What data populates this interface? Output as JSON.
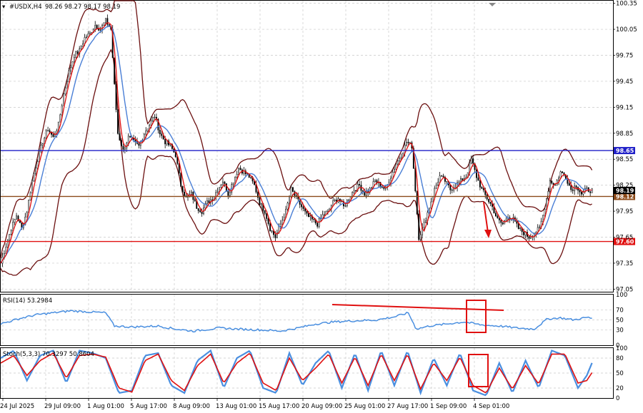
{
  "header": {
    "symbol_label": "#USDX,H4",
    "ohlc": "98.26 98.27 98.17 98.19"
  },
  "rsi_panel": {
    "label": "RSI(14) 53.2984",
    "levels": [
      "100",
      "70",
      "50",
      "30",
      "0"
    ]
  },
  "stoch_panel": {
    "label": "Stoch(5,3,3) 70.3297 50.8604",
    "levels": [
      "100",
      "80",
      "50",
      "20",
      "0"
    ]
  },
  "colors": {
    "candle": "#000000",
    "bollinger": "#6b0f0f",
    "ma_fast": "#e01010",
    "ma_slow": "#4a7fd6",
    "resistance": "#1f1fc8",
    "support": "#e01010",
    "current": "#8b4a1a",
    "rsi": "#4a8fe0",
    "stoch_main": "#4a8fe0",
    "stoch_signal": "#e01010",
    "annotation": "#e01010"
  },
  "chart_data": [
    {
      "type": "candlestick",
      "title": "#USDX,H4",
      "y_ticks": [
        "100.35",
        "100.05",
        "99.75",
        "99.45",
        "99.15",
        "98.85",
        "98.55",
        "98.25",
        "97.95",
        "97.65",
        "97.35",
        "97.05"
      ],
      "ylim": [
        97.02,
        100.38
      ],
      "x_ticks": [
        "24 Jul 2025",
        "29 Jul 09:00",
        "1 Aug 01:00",
        "5 Aug 17:00",
        "8 Aug 09:00",
        "13 Aug 01:00",
        "15 Aug 17:00",
        "20 Aug 09:00",
        "25 Aug 01:00",
        "27 Aug 17:00",
        "1 Sep 09:00",
        "4 Sep 01:00"
      ],
      "horizontal_lines": [
        {
          "label": "98.65",
          "value": 98.65,
          "color": "#1f1fc8"
        },
        {
          "label": "97.60",
          "value": 97.6,
          "color": "#e01010"
        },
        {
          "label": "98.12",
          "value": 98.12,
          "color": "#8b4a1a"
        }
      ],
      "current_price_label": "98.19",
      "current_price": 98.19,
      "price_path": [
        [
          0,
          97.35
        ],
        [
          6,
          97.55
        ],
        [
          12,
          97.75
        ],
        [
          18,
          97.9
        ],
        [
          24,
          97.75
        ],
        [
          30,
          97.95
        ],
        [
          36,
          98.3
        ],
        [
          42,
          98.55
        ],
        [
          48,
          98.75
        ],
        [
          54,
          98.9
        ],
        [
          60,
          98.8
        ],
        [
          66,
          98.95
        ],
        [
          72,
          99.3
        ],
        [
          78,
          99.55
        ],
        [
          84,
          99.75
        ],
        [
          90,
          99.8
        ],
        [
          96,
          99.95
        ],
        [
          102,
          100.0
        ],
        [
          108,
          100.1
        ],
        [
          114,
          100.05
        ],
        [
          120,
          100.15
        ],
        [
          126,
          100.05
        ],
        [
          130,
          99.4
        ],
        [
          134,
          98.85
        ],
        [
          140,
          98.65
        ],
        [
          146,
          98.8
        ],
        [
          152,
          98.75
        ],
        [
          158,
          98.7
        ],
        [
          164,
          98.85
        ],
        [
          170,
          98.95
        ],
        [
          176,
          99.05
        ],
        [
          182,
          98.85
        ],
        [
          188,
          98.75
        ],
        [
          194,
          98.7
        ],
        [
          200,
          98.6
        ],
        [
          206,
          98.25
        ],
        [
          212,
          98.1
        ],
        [
          218,
          98.15
        ],
        [
          224,
          98.0
        ],
        [
          230,
          97.95
        ],
        [
          236,
          98.05
        ],
        [
          242,
          98.1
        ],
        [
          248,
          98.2
        ],
        [
          254,
          98.3
        ],
        [
          260,
          98.15
        ],
        [
          266,
          98.3
        ],
        [
          272,
          98.45
        ],
        [
          278,
          98.4
        ],
        [
          284,
          98.35
        ],
        [
          290,
          98.25
        ],
        [
          296,
          98.05
        ],
        [
          302,
          97.95
        ],
        [
          308,
          97.75
        ],
        [
          314,
          97.65
        ],
        [
          320,
          97.8
        ],
        [
          326,
          97.95
        ],
        [
          332,
          98.2
        ],
        [
          338,
          98.1
        ],
        [
          344,
          98.0
        ],
        [
          350,
          97.9
        ],
        [
          356,
          97.85
        ],
        [
          362,
          97.8
        ],
        [
          368,
          97.9
        ],
        [
          374,
          97.95
        ],
        [
          380,
          98.05
        ],
        [
          386,
          98.1
        ],
        [
          392,
          98.0
        ],
        [
          398,
          98.1
        ],
        [
          404,
          98.2
        ],
        [
          410,
          98.25
        ],
        [
          416,
          98.15
        ],
        [
          422,
          98.2
        ],
        [
          428,
          98.3
        ],
        [
          434,
          98.25
        ],
        [
          440,
          98.2
        ],
        [
          446,
          98.35
        ],
        [
          452,
          98.5
        ],
        [
          458,
          98.6
        ],
        [
          464,
          98.75
        ],
        [
          470,
          98.7
        ],
        [
          474,
          98.2
        ],
        [
          478,
          97.65
        ],
        [
          484,
          97.8
        ],
        [
          490,
          98.0
        ],
        [
          496,
          98.2
        ],
        [
          502,
          98.35
        ],
        [
          508,
          98.3
        ],
        [
          514,
          98.2
        ],
        [
          520,
          98.25
        ],
        [
          526,
          98.3
        ],
        [
          532,
          98.35
        ],
        [
          538,
          98.55
        ],
        [
          544,
          98.35
        ],
        [
          550,
          98.2
        ],
        [
          556,
          98.1
        ],
        [
          562,
          98.0
        ],
        [
          568,
          97.85
        ],
        [
          574,
          97.8
        ],
        [
          580,
          97.9
        ],
        [
          586,
          97.85
        ],
        [
          592,
          97.75
        ],
        [
          598,
          97.7
        ],
        [
          604,
          97.65
        ],
        [
          610,
          97.7
        ],
        [
          616,
          97.75
        ],
        [
          620,
          97.9
        ],
        [
          624,
          98.1
        ],
        [
          628,
          98.3
        ],
        [
          634,
          98.25
        ],
        [
          640,
          98.4
        ],
        [
          646,
          98.35
        ],
        [
          652,
          98.2
        ],
        [
          658,
          98.25
        ],
        [
          664,
          98.15
        ],
        [
          670,
          98.2
        ],
        [
          676,
          98.19
        ]
      ]
    },
    {
      "type": "line",
      "title": "RSI(14) 53.2984",
      "ylim": [
        0,
        100
      ],
      "y_ticks": [
        100,
        70,
        50,
        30,
        0
      ],
      "series": [
        {
          "name": "RSI(14)",
          "values": [
            [
              0,
              42
            ],
            [
              20,
              52
            ],
            [
              40,
              60
            ],
            [
              60,
              64
            ],
            [
              80,
              68
            ],
            [
              100,
              66
            ],
            [
              120,
              64
            ],
            [
              130,
              38
            ],
            [
              150,
              36
            ],
            [
              180,
              38
            ],
            [
              200,
              32
            ],
            [
              220,
              28
            ],
            [
              250,
              34
            ],
            [
              270,
              32
            ],
            [
              300,
              30
            ],
            [
              320,
              28
            ],
            [
              340,
              34
            ],
            [
              360,
              42
            ],
            [
              380,
              46
            ],
            [
              400,
              48
            ],
            [
              430,
              50
            ],
            [
              450,
              56
            ],
            [
              466,
              64
            ],
            [
              475,
              32
            ],
            [
              490,
              38
            ],
            [
              510,
              42
            ],
            [
              530,
              46
            ],
            [
              550,
              40
            ],
            [
              570,
              38
            ],
            [
              590,
              34
            ],
            [
              610,
              32
            ],
            [
              625,
              52
            ],
            [
              640,
              54
            ],
            [
              655,
              50
            ],
            [
              670,
              55
            ],
            [
              676,
              53.3
            ]
          ]
        }
      ]
    },
    {
      "type": "line",
      "title": "Stoch(5,3,3) 70.3297 50.8604",
      "ylim": [
        0,
        100
      ],
      "y_ticks": [
        100,
        80,
        50,
        20,
        0
      ],
      "series": [
        {
          "name": "Stoch(5,3,3)",
          "values": [
            [
              0,
              80
            ],
            [
              15,
              95
            ],
            [
              30,
              35
            ],
            [
              45,
              85
            ],
            [
              60,
              95
            ],
            [
              75,
              30
            ],
            [
              90,
              95
            ],
            [
              105,
              90
            ],
            [
              120,
              80
            ],
            [
              135,
              10
            ],
            [
              150,
              15
            ],
            [
              165,
              85
            ],
            [
              180,
              90
            ],
            [
              195,
              25
            ],
            [
              210,
              10
            ],
            [
              225,
              75
            ],
            [
              240,
              95
            ],
            [
              255,
              20
            ],
            [
              270,
              80
            ],
            [
              285,
              95
            ],
            [
              300,
              20
            ],
            [
              315,
              10
            ],
            [
              330,
              90
            ],
            [
              345,
              25
            ],
            [
              360,
              70
            ],
            [
              375,
              95
            ],
            [
              390,
              20
            ],
            [
              405,
              90
            ],
            [
              420,
              15
            ],
            [
              435,
              95
            ],
            [
              450,
              25
            ],
            [
              465,
              95
            ],
            [
              480,
              10
            ],
            [
              495,
              80
            ],
            [
              510,
              25
            ],
            [
              525,
              90
            ],
            [
              540,
              15
            ],
            [
              555,
              5
            ],
            [
              570,
              70
            ],
            [
              585,
              10
            ],
            [
              600,
              75
            ],
            [
              615,
              20
            ],
            [
              630,
              95
            ],
            [
              645,
              85
            ],
            [
              660,
              20
            ],
            [
              670,
              45
            ],
            [
              676,
              70.3
            ]
          ]
        },
        {
          "name": "Signal",
          "values": [
            [
              0,
              70
            ],
            [
              15,
              85
            ],
            [
              30,
              45
            ],
            [
              45,
              75
            ],
            [
              60,
              90
            ],
            [
              75,
              40
            ],
            [
              90,
              85
            ],
            [
              105,
              88
            ],
            [
              120,
              82
            ],
            [
              135,
              20
            ],
            [
              150,
              12
            ],
            [
              165,
              75
            ],
            [
              180,
              88
            ],
            [
              195,
              35
            ],
            [
              210,
              15
            ],
            [
              225,
              65
            ],
            [
              240,
              88
            ],
            [
              255,
              30
            ],
            [
              270,
              70
            ],
            [
              285,
              90
            ],
            [
              300,
              30
            ],
            [
              315,
              15
            ],
            [
              330,
              80
            ],
            [
              345,
              35
            ],
            [
              360,
              60
            ],
            [
              375,
              88
            ],
            [
              390,
              30
            ],
            [
              405,
              82
            ],
            [
              420,
              25
            ],
            [
              435,
              88
            ],
            [
              450,
              35
            ],
            [
              465,
              88
            ],
            [
              480,
              18
            ],
            [
              495,
              70
            ],
            [
              510,
              35
            ],
            [
              525,
              82
            ],
            [
              540,
              25
            ],
            [
              555,
              10
            ],
            [
              570,
              60
            ],
            [
              585,
              18
            ],
            [
              600,
              65
            ],
            [
              615,
              28
            ],
            [
              630,
              88
            ],
            [
              645,
              88
            ],
            [
              660,
              30
            ],
            [
              670,
              35
            ],
            [
              676,
              50.9
            ]
          ]
        }
      ]
    }
  ]
}
